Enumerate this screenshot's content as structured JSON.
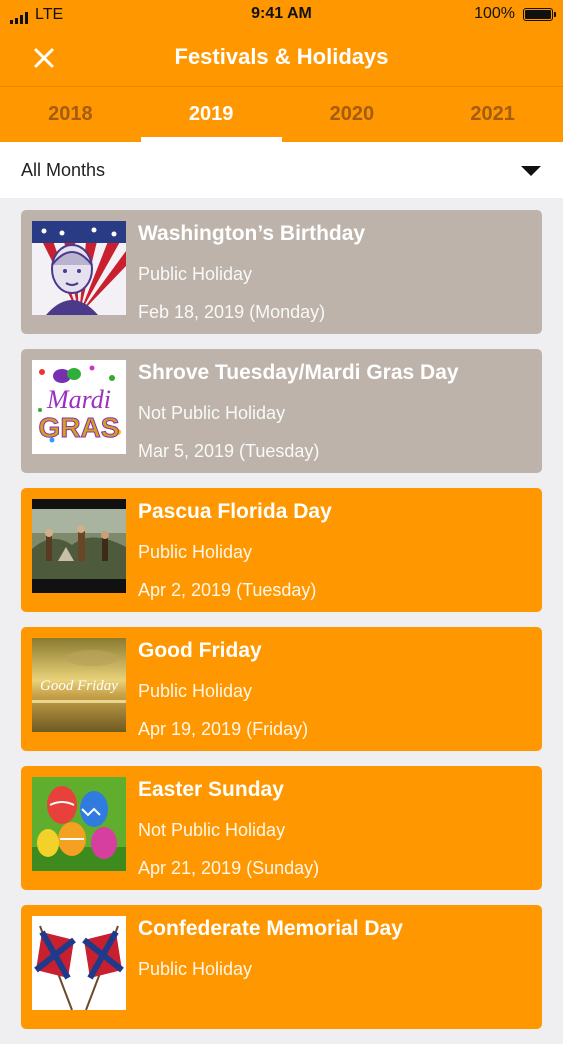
{
  "status_bar": {
    "carrier": "LTE",
    "time": "9:41 AM",
    "battery": "100%"
  },
  "navbar": {
    "title": "Festivals & Holidays",
    "close_icon": "close-icon"
  },
  "tabs": [
    {
      "label": "2018",
      "active": false
    },
    {
      "label": "2019",
      "active": true
    },
    {
      "label": "2020",
      "active": false
    },
    {
      "label": "2021",
      "active": false
    }
  ],
  "month_filter": {
    "selected": "All Months",
    "icon": "caret-down-icon"
  },
  "holidays": [
    {
      "name": "Washington’s Birthday",
      "type": "Public Holiday",
      "date": "Feb 18, 2019 (Monday)",
      "style": "grey",
      "icon": "washington-portrait-icon"
    },
    {
      "name": "Shrove Tuesday/Mardi Gras Day",
      "type": "Not Public Holiday",
      "date": "Mar 5, 2019 (Tuesday)",
      "style": "grey",
      "icon": "mardi-gras-icon",
      "thumb_line1": "Mardi",
      "thumb_line2": "GRAS"
    },
    {
      "name": "Pascua Florida Day",
      "type": "Public Holiday",
      "date": "Apr 2, 2019 (Tuesday)",
      "style": "orange",
      "icon": "historic-painting-icon"
    },
    {
      "name": "Good Friday",
      "type": "Public Holiday",
      "date": "Apr 19, 2019 (Friday)",
      "style": "orange",
      "icon": "good-friday-sunset-icon",
      "thumb_text": "Good Friday"
    },
    {
      "name": "Easter Sunday",
      "type": "Not Public Holiday",
      "date": "Apr 21, 2019 (Sunday)",
      "style": "orange",
      "icon": "easter-eggs-icon"
    },
    {
      "name": "Confederate Memorial Day",
      "type": "Public Holiday",
      "date": "",
      "style": "orange",
      "icon": "confederate-flags-icon"
    }
  ],
  "colors": {
    "brand_orange": "#ff9800",
    "past_grey": "#bdb3aa",
    "inactive_tab": "#a35c10"
  }
}
